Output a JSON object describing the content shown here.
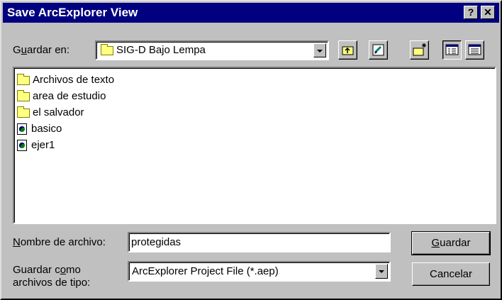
{
  "window": {
    "title": "Save ArcExplorer View",
    "help_label": "?",
    "close_label": "✕"
  },
  "location": {
    "label_pre": "G",
    "label_mnemonic": "u",
    "label_post": "ardar en:",
    "value": "SIG-D Bajo Lempa"
  },
  "toolbar": {
    "icons": [
      "up-one-level-icon",
      "go-to-home-icon",
      "new-folder-icon",
      "list-view-icon",
      "details-view-icon"
    ]
  },
  "files": [
    {
      "name": "Archivos de texto",
      "type": "folder"
    },
    {
      "name": "area de estudio",
      "type": "folder"
    },
    {
      "name": "el salvador",
      "type": "folder"
    },
    {
      "name": "basico",
      "type": "project"
    },
    {
      "name": "ejer1",
      "type": "project"
    }
  ],
  "filename": {
    "label_mnemonic": "N",
    "label_post": "ombre de archivo:",
    "value": "protegidas"
  },
  "filetype": {
    "label_line1_pre": "Guardar c",
    "label_line1_mnemonic": "o",
    "label_line1_post": "mo",
    "label_line2": "archivos de tipo:",
    "value": "ArcExplorer Project File (*.aep)"
  },
  "buttons": {
    "save_mnemonic": "G",
    "save_post": "uardar",
    "cancel": "Cancelar"
  },
  "colors": {
    "titlebar": "#000080",
    "face": "#c0c0c0",
    "folder": "#ffff80"
  }
}
